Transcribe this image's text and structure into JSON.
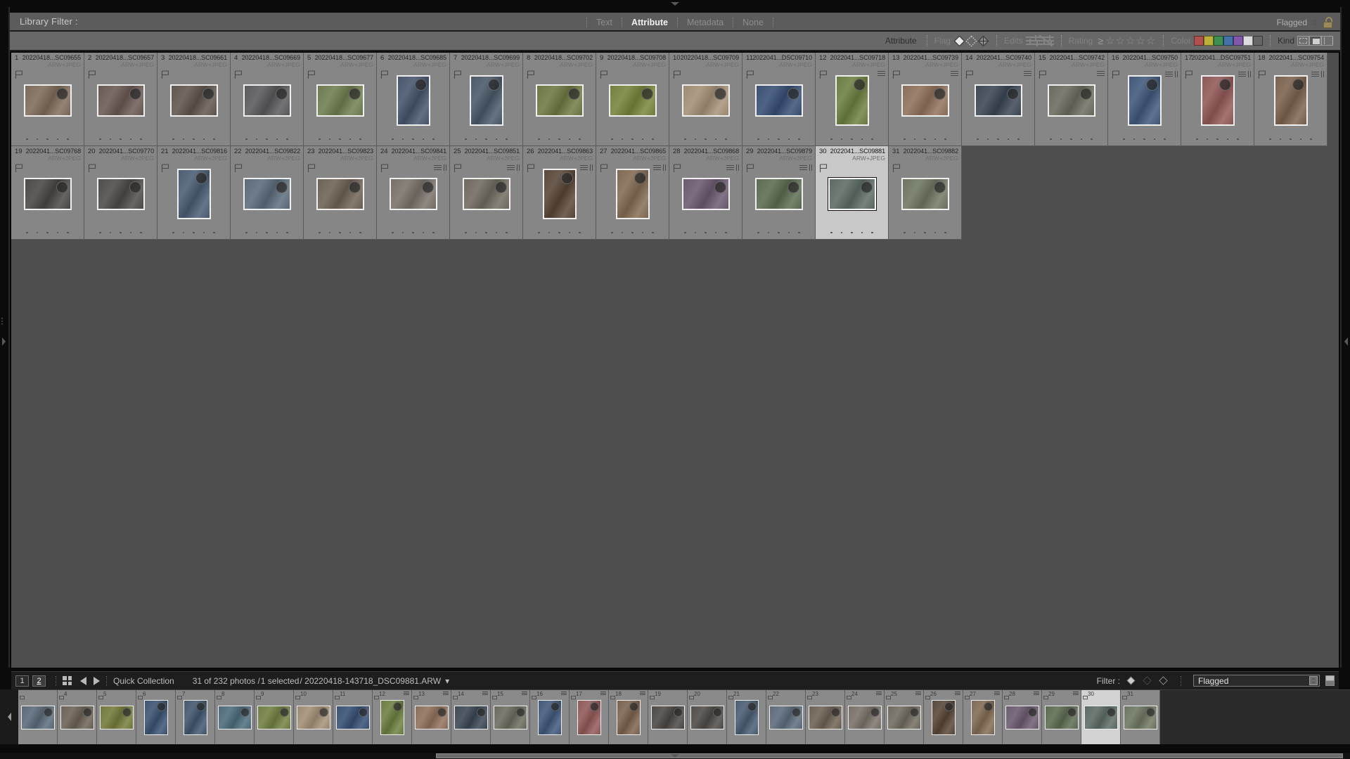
{
  "app": {
    "filter_title": "Library Filter :",
    "filter_tabs": [
      {
        "label": "Text",
        "active": false
      },
      {
        "label": "Attribute",
        "active": true
      },
      {
        "label": "Metadata",
        "active": false
      },
      {
        "label": "None",
        "active": false
      }
    ],
    "header_right": {
      "preset_label": "Flagged",
      "lock_icon": "lock-icon"
    }
  },
  "attribute_bar": {
    "attribute_label": "Attribute",
    "flag_label": "Flag",
    "flag_icons": [
      "flag-flagged-icon",
      "flag-unflagged-icon",
      "flag-rejected-icon"
    ],
    "edits_label": "Edits",
    "edits_icons": [
      "edited-icon",
      "unedited-icon"
    ],
    "rating_label": "Rating",
    "rating_operator": "≥",
    "stars": 5,
    "color_label": "Color",
    "colors": [
      "#b0514f",
      "#bab03a",
      "#3f8f52",
      "#4472a8",
      "#8358ac",
      "#dcdcdc",
      "#666666"
    ],
    "kind_label": "Kind",
    "kind_icons": [
      "master-photo-icon",
      "virtual-copy-icon",
      "video-icon"
    ]
  },
  "grid": {
    "rows": [
      [
        {
          "index": "1",
          "name": "20220418...SC09655",
          "format": "ARW+JPEG",
          "orient": "landscape",
          "selected": false,
          "badges": [],
          "color": "#7c6a5b"
        },
        {
          "index": "2",
          "name": "20220418...SC09657",
          "format": "ARW+JPEG",
          "orient": "landscape",
          "selected": false,
          "badges": [],
          "color": "#6a5a56"
        },
        {
          "index": "3",
          "name": "20220418...SC09661",
          "format": "ARW+JPEG",
          "orient": "landscape",
          "selected": false,
          "badges": [],
          "color": "#5f5750"
        },
        {
          "index": "4",
          "name": "20220418...SC09669",
          "format": "ARW+JPEG",
          "orient": "landscape",
          "selected": false,
          "badges": [],
          "color": "#5b5b5d"
        },
        {
          "index": "5",
          "name": "20220418...SC09677",
          "format": "ARW+JPEG",
          "orient": "landscape",
          "selected": false,
          "badges": [],
          "color": "#6e7a52"
        },
        {
          "index": "6",
          "name": "20220418...SC09685",
          "format": "ARW+JPEG",
          "orient": "portrait",
          "selected": false,
          "badges": [],
          "color": "#49566b"
        },
        {
          "index": "7",
          "name": "20220418...SC09699",
          "format": "ARW+JPEG",
          "orient": "portrait",
          "selected": false,
          "badges": [],
          "color": "#4d5a68"
        },
        {
          "index": "8",
          "name": "20220418...SC09702",
          "format": "ARW+JPEG",
          "orient": "landscape",
          "selected": false,
          "badges": [],
          "color": "#6d7646"
        },
        {
          "index": "9",
          "name": "20220418...SC09708",
          "format": "ARW+JPEG",
          "orient": "landscape",
          "selected": false,
          "badges": [],
          "color": "#74803f"
        },
        {
          "index": "10",
          "name": "20220418...SC09709",
          "format": "ARW+JPEG",
          "orient": "landscape",
          "selected": false,
          "badges": [],
          "color": "#9c8a74"
        },
        {
          "index": "11",
          "name": "2022041...DSC09710",
          "format": "ARW+JPEG",
          "orient": "landscape",
          "selected": false,
          "badges": [],
          "color": "#3d5272"
        },
        {
          "index": "12",
          "name": "2022041...SC09718",
          "format": "ARW+JPEG",
          "orient": "portrait",
          "selected": false,
          "badges": [
            "lines"
          ],
          "color": "#6c7c45"
        },
        {
          "index": "13",
          "name": "2022041...SC09739",
          "format": "ARW+JPEG",
          "orient": "landscape",
          "selected": false,
          "badges": [
            "lines"
          ],
          "color": "#8a6f5c"
        },
        {
          "index": "14",
          "name": "2022041...SC09740",
          "format": "ARW+JPEG",
          "orient": "landscape",
          "selected": false,
          "badges": [
            "lines"
          ],
          "color": "#3f4a56"
        },
        {
          "index": "15",
          "name": "2022041...SC09742",
          "format": "ARW+JPEG",
          "orient": "landscape",
          "selected": false,
          "badges": [
            "lines"
          ],
          "color": "#6b6a5e"
        },
        {
          "index": "16",
          "name": "2022041...SC09750",
          "format": "ARW+JPEG",
          "orient": "portrait",
          "selected": false,
          "badges": [
            "lines",
            "crop"
          ],
          "color": "#455a79"
        },
        {
          "index": "17",
          "name": "2022041...DSC09751",
          "format": "ARW+JPEG",
          "orient": "portrait",
          "selected": false,
          "badges": [
            "lines",
            "crop"
          ],
          "color": "#8d5a5a"
        },
        {
          "index": "18",
          "name": "2022041...SC09754",
          "format": "ARW+JPEG",
          "orient": "portrait",
          "selected": false,
          "badges": [
            "lines",
            "crop"
          ],
          "color": "#7a6250"
        }
      ],
      [
        {
          "index": "19",
          "name": "2022041...SC09768",
          "format": "ARW+JPEG",
          "orient": "landscape",
          "selected": false,
          "badges": [],
          "color": "#4d4a47"
        },
        {
          "index": "20",
          "name": "2022041...SC09770",
          "format": "ARW+JPEG",
          "orient": "landscape",
          "selected": false,
          "badges": [],
          "color": "#504d4a"
        },
        {
          "index": "21",
          "name": "2022041...SC09816",
          "format": "ARW+JPEG",
          "orient": "portrait",
          "selected": false,
          "badges": [],
          "color": "#4e5e72"
        },
        {
          "index": "22",
          "name": "2022041...SC09822",
          "format": "ARW+JPEG",
          "orient": "landscape",
          "selected": false,
          "badges": [],
          "color": "#5d6a78"
        },
        {
          "index": "23",
          "name": "2022041...SC09823",
          "format": "ARW+JPEG",
          "orient": "landscape",
          "selected": false,
          "badges": [],
          "color": "#6d6256"
        },
        {
          "index": "24",
          "name": "2022041...SC09841",
          "format": "ARW+JPEG",
          "orient": "landscape",
          "selected": false,
          "badges": [
            "lines",
            "crop"
          ],
          "color": "#777068"
        },
        {
          "index": "25",
          "name": "2022041...SC09851",
          "format": "ARW+JPEG",
          "orient": "landscape",
          "selected": false,
          "badges": [
            "lines",
            "crop"
          ],
          "color": "#6f6a60"
        },
        {
          "index": "26",
          "name": "2022041...SC09863",
          "format": "ARW+JPEG",
          "orient": "portrait",
          "selected": false,
          "badges": [
            "lines",
            "crop"
          ],
          "color": "#5a4a3e"
        },
        {
          "index": "27",
          "name": "2022041...SC09865",
          "format": "ARW+JPEG",
          "orient": "portrait",
          "selected": false,
          "badges": [
            "lines",
            "crop"
          ],
          "color": "#7e6a55"
        },
        {
          "index": "28",
          "name": "2022041...SC09868",
          "format": "ARW+JPEG",
          "orient": "landscape",
          "selected": false,
          "badges": [
            "lines",
            "crop"
          ],
          "color": "#6a5c6e"
        },
        {
          "index": "29",
          "name": "2022041...SC09879",
          "format": "ARW+JPEG",
          "orient": "landscape",
          "selected": false,
          "badges": [
            "lines",
            "crop"
          ],
          "color": "#5d6a54"
        },
        {
          "index": "30",
          "name": "2022041...SC09881",
          "format": "ARW+JPEG",
          "orient": "landscape",
          "selected": true,
          "badges": [],
          "color": "#5d6b64"
        },
        {
          "index": "31",
          "name": "2022041...SC09882",
          "format": "ARW+JPEG",
          "orient": "landscape",
          "selected": false,
          "badges": [],
          "color": "#6d7562"
        }
      ]
    ]
  },
  "toolbar": {
    "page_buttons": [
      "1",
      "2"
    ],
    "grid_icon": "grid-view-icon",
    "prev_icon": "previous-photo-icon",
    "next_icon": "next-photo-icon",
    "quick_collection_label": "Quick Collection",
    "status_prefix": "31 of 232 photos /",
    "status_selected": "1 selected",
    "status_file": "/ 20220418-143718_DSC09881.ARW",
    "status_caret": "▾",
    "filter_label": "Filter :",
    "filter_flags": [
      "flag-flagged-icon",
      "flag-unflagged-icon",
      "flag-rejected-icon"
    ],
    "filter_preset": "Flagged"
  },
  "filmstrip": {
    "cells": [
      {
        "num": "",
        "selected": false,
        "color": "#5c6a78",
        "orient": "landscape",
        "badges": []
      },
      {
        "num": "4",
        "selected": false,
        "color": "#6b6257",
        "orient": "landscape",
        "badges": []
      },
      {
        "num": "5",
        "selected": false,
        "color": "#72783f",
        "orient": "landscape",
        "badges": []
      },
      {
        "num": "6",
        "selected": false,
        "color": "#3f5570",
        "orient": "portrait",
        "badges": []
      },
      {
        "num": "7",
        "selected": false,
        "color": "#45586e",
        "orient": "portrait",
        "badges": []
      },
      {
        "num": "8",
        "selected": false,
        "color": "#4f6a78",
        "orient": "landscape",
        "badges": []
      },
      {
        "num": "9",
        "selected": false,
        "color": "#707c46",
        "orient": "landscape",
        "badges": []
      },
      {
        "num": "10",
        "selected": false,
        "color": "#9a8a74",
        "orient": "landscape",
        "badges": []
      },
      {
        "num": "11",
        "selected": false,
        "color": "#3d5272",
        "orient": "landscape",
        "badges": []
      },
      {
        "num": "12",
        "selected": false,
        "color": "#6c7c45",
        "orient": "portrait",
        "badges": [
          "lines"
        ]
      },
      {
        "num": "13",
        "selected": false,
        "color": "#8a6f5c",
        "orient": "landscape",
        "badges": [
          "lines"
        ]
      },
      {
        "num": "14",
        "selected": false,
        "color": "#3f4a56",
        "orient": "landscape",
        "badges": [
          "lines"
        ]
      },
      {
        "num": "15",
        "selected": false,
        "color": "#6b6a5e",
        "orient": "landscape",
        "badges": [
          "lines"
        ]
      },
      {
        "num": "16",
        "selected": false,
        "color": "#455a79",
        "orient": "portrait",
        "badges": [
          "lines"
        ]
      },
      {
        "num": "17",
        "selected": false,
        "color": "#8d5a5a",
        "orient": "portrait",
        "badges": [
          "lines"
        ]
      },
      {
        "num": "18",
        "selected": false,
        "color": "#7a6250",
        "orient": "portrait",
        "badges": [
          "lines"
        ]
      },
      {
        "num": "19",
        "selected": false,
        "color": "#4d4a47",
        "orient": "landscape",
        "badges": []
      },
      {
        "num": "20",
        "selected": false,
        "color": "#504d4a",
        "orient": "landscape",
        "badges": []
      },
      {
        "num": "21",
        "selected": false,
        "color": "#4e5e72",
        "orient": "portrait",
        "badges": []
      },
      {
        "num": "22",
        "selected": false,
        "color": "#5d6a78",
        "orient": "landscape",
        "badges": []
      },
      {
        "num": "23",
        "selected": false,
        "color": "#6d6256",
        "orient": "landscape",
        "badges": []
      },
      {
        "num": "24",
        "selected": false,
        "color": "#777068",
        "orient": "landscape",
        "badges": [
          "lines"
        ]
      },
      {
        "num": "25",
        "selected": false,
        "color": "#6f6a60",
        "orient": "landscape",
        "badges": [
          "lines"
        ]
      },
      {
        "num": "26",
        "selected": false,
        "color": "#5a4a3e",
        "orient": "portrait",
        "badges": [
          "lines"
        ]
      },
      {
        "num": "27",
        "selected": false,
        "color": "#7e6a55",
        "orient": "portrait",
        "badges": [
          "lines"
        ]
      },
      {
        "num": "28",
        "selected": false,
        "color": "#6a5c6e",
        "orient": "landscape",
        "badges": [
          "lines"
        ]
      },
      {
        "num": "29",
        "selected": false,
        "color": "#5d6a54",
        "orient": "landscape",
        "badges": [
          "lines"
        ]
      },
      {
        "num": "30",
        "selected": true,
        "color": "#5d6b64",
        "orient": "landscape",
        "badges": []
      },
      {
        "num": "31",
        "selected": false,
        "color": "#6d7562",
        "orient": "landscape",
        "badges": []
      }
    ]
  }
}
